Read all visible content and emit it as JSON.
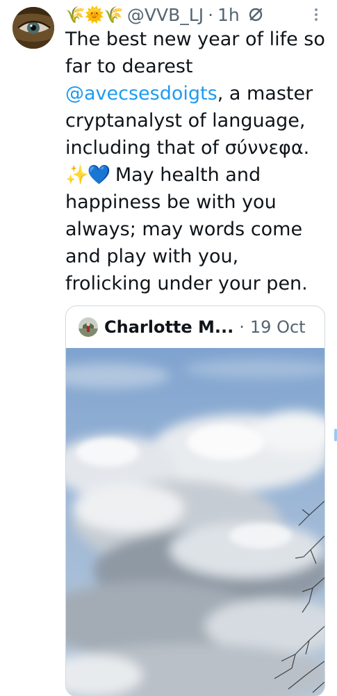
{
  "tweet": {
    "header_emoji": "🌾🌞🌾",
    "handle": "@VVB_LJ",
    "separator": "·",
    "time": "1h",
    "text_part1": "The best new year of life so far to dearest ",
    "mention": "@avecsesdoigts",
    "text_part2": ", a master cryptanalyst of language, including that of σύννεφα. ",
    "inline_emoji": "✨💙",
    "text_part3": " May health and happiness be with you always; may words come and play with you, frolicking under your pen."
  },
  "quote": {
    "author_name": "Charlotte M...",
    "separator": "·",
    "date": "19 Oct"
  },
  "colors": {
    "text": "#0f1419",
    "secondary": "#536471",
    "link": "#1d9bf0",
    "border": "#cfd9de"
  },
  "icons": {
    "more": "vertical-dots-icon",
    "grok": "circle-slash-icon"
  }
}
